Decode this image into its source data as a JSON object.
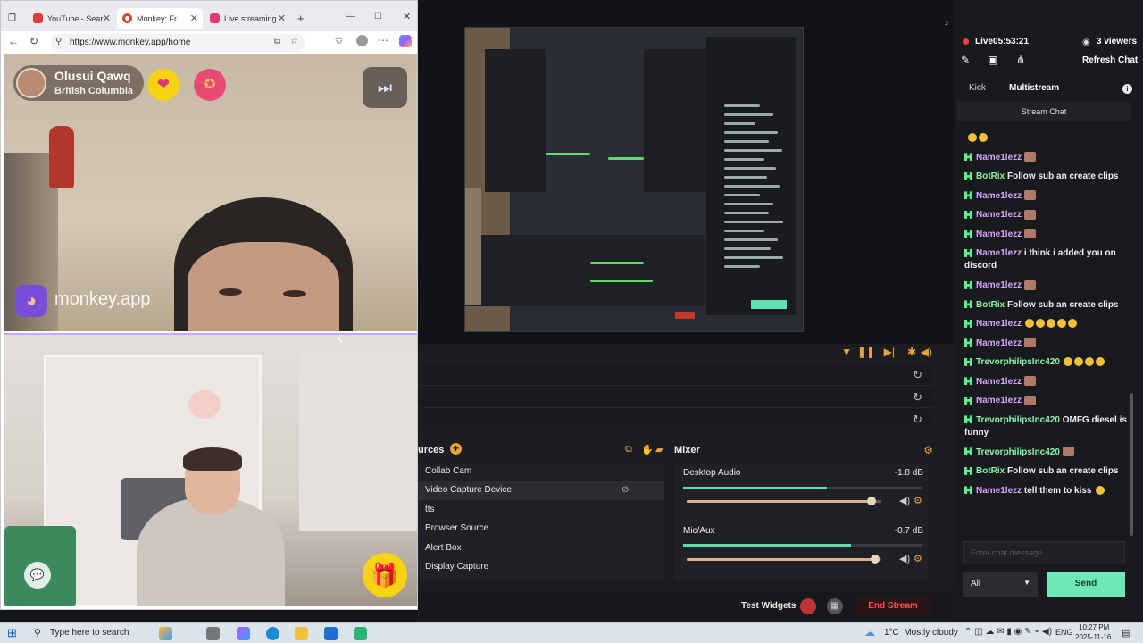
{
  "browser": {
    "tabs": [
      {
        "label": "YouTube - Sear",
        "favicon_color": "#e23b3b"
      },
      {
        "label": "Monkey: Fr",
        "favicon_color": "#d84a2b"
      },
      {
        "label": "Live streaming",
        "favicon_color": "#e03870"
      }
    ],
    "url": "https://www.monkey.app/home"
  },
  "monkey": {
    "peer_name": "Olusui Qawq",
    "peer_location": "British Columbia",
    "watermark": "monkey.app"
  },
  "obs": {
    "sources_title": "urces",
    "sources": [
      "Collab Cam",
      "Video Capture Device",
      "tts",
      "Browser Source",
      "Alert Box",
      "Display Capture"
    ],
    "mixer_title": "Mixer",
    "channels": [
      {
        "name": "Desktop Audio",
        "db": "-1.8 dB",
        "level": 0.6,
        "volume": 0.95
      },
      {
        "name": "Mic/Aux",
        "db": "-0.7 dB",
        "level": 0.7,
        "volume": 0.97
      }
    ],
    "test_widgets": "Test Widgets",
    "end_stream": "End Stream"
  },
  "chat": {
    "live_time": "Live05:53:21",
    "viewers": "3 viewers",
    "refresh": "Refresh Chat",
    "tabs": [
      "Kick",
      "Multistream"
    ],
    "stream_chat": "Stream Chat",
    "messages": [
      {
        "user": "",
        "text": "",
        "emoji": 2
      },
      {
        "user": "Name1lezz",
        "text": "",
        "color": "p",
        "avatar": true
      },
      {
        "user": "BotRix",
        "text": "Follow sub an create clips",
        "color": "g"
      },
      {
        "user": "Name1lezz",
        "text": "",
        "color": "p",
        "avatar": true
      },
      {
        "user": "Name1lezz",
        "text": "",
        "color": "p",
        "avatar": true
      },
      {
        "user": "Name1lezz",
        "text": "",
        "color": "p",
        "avatar": true
      },
      {
        "user": "Name1lezz",
        "text": "i think i added you on discord",
        "color": "p"
      },
      {
        "user": "Name1lezz",
        "text": "",
        "color": "p",
        "avatar": true
      },
      {
        "user": "BotRix",
        "text": "Follow sub an create clips",
        "color": "g"
      },
      {
        "user": "Name1lezz",
        "text": "",
        "color": "p",
        "emoji": 5
      },
      {
        "user": "Name1lezz",
        "text": "",
        "color": "p",
        "avatar": true
      },
      {
        "user": "TrevorphilipsInc420",
        "text": "",
        "color": "g",
        "emoji": 4
      },
      {
        "user": "Name1lezz",
        "text": "",
        "color": "p",
        "avatar": true
      },
      {
        "user": "Name1lezz",
        "text": "",
        "color": "p",
        "avatar": true
      },
      {
        "user": "TrevorphilipsInc420",
        "text": "OMFG diesel is funny",
        "color": "g"
      },
      {
        "user": "TrevorphilipsInc420",
        "text": "",
        "color": "g",
        "avatar": true
      },
      {
        "user": "BotRix",
        "text": "Follow sub an create clips",
        "color": "g"
      },
      {
        "user": "Name1lezz",
        "text": "tell them to kiss",
        "color": "p",
        "emoji": 1
      }
    ],
    "input_placeholder": "Enter chat message",
    "select_value": "All",
    "send": "Send"
  },
  "taskbar": {
    "search_placeholder": "Type here to search",
    "weather": "1°C  Mostly cloudy",
    "lang": "ENG",
    "time": "10:27 PM",
    "date": "2025-11-16"
  }
}
